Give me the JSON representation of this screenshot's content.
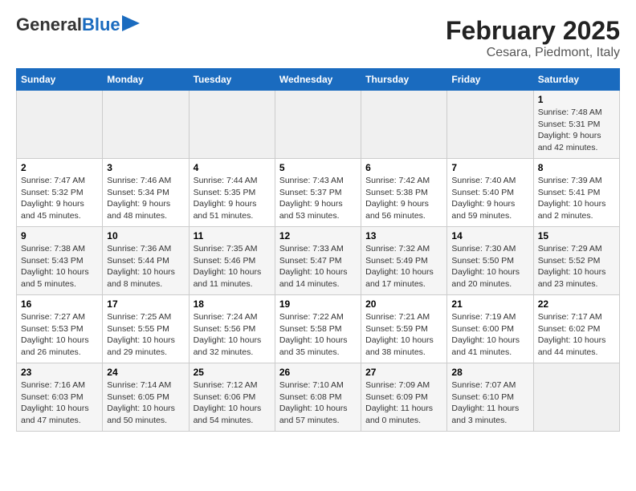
{
  "header": {
    "logo_line1": "General",
    "logo_line2": "Blue",
    "month_title": "February 2025",
    "location": "Cesara, Piedmont, Italy"
  },
  "weekdays": [
    "Sunday",
    "Monday",
    "Tuesday",
    "Wednesday",
    "Thursday",
    "Friday",
    "Saturday"
  ],
  "weeks": [
    [
      {
        "day": "",
        "sunrise": "",
        "sunset": "",
        "daylight": "",
        "empty": true
      },
      {
        "day": "",
        "sunrise": "",
        "sunset": "",
        "daylight": "",
        "empty": true
      },
      {
        "day": "",
        "sunrise": "",
        "sunset": "",
        "daylight": "",
        "empty": true
      },
      {
        "day": "",
        "sunrise": "",
        "sunset": "",
        "daylight": "",
        "empty": true
      },
      {
        "day": "",
        "sunrise": "",
        "sunset": "",
        "daylight": "",
        "empty": true
      },
      {
        "day": "",
        "sunrise": "",
        "sunset": "",
        "daylight": "",
        "empty": true
      },
      {
        "day": "1",
        "sunrise": "Sunrise: 7:48 AM",
        "sunset": "Sunset: 5:31 PM",
        "daylight": "Daylight: 9 hours and 42 minutes."
      }
    ],
    [
      {
        "day": "2",
        "sunrise": "Sunrise: 7:47 AM",
        "sunset": "Sunset: 5:32 PM",
        "daylight": "Daylight: 9 hours and 45 minutes."
      },
      {
        "day": "3",
        "sunrise": "Sunrise: 7:46 AM",
        "sunset": "Sunset: 5:34 PM",
        "daylight": "Daylight: 9 hours and 48 minutes."
      },
      {
        "day": "4",
        "sunrise": "Sunrise: 7:44 AM",
        "sunset": "Sunset: 5:35 PM",
        "daylight": "Daylight: 9 hours and 51 minutes."
      },
      {
        "day": "5",
        "sunrise": "Sunrise: 7:43 AM",
        "sunset": "Sunset: 5:37 PM",
        "daylight": "Daylight: 9 hours and 53 minutes."
      },
      {
        "day": "6",
        "sunrise": "Sunrise: 7:42 AM",
        "sunset": "Sunset: 5:38 PM",
        "daylight": "Daylight: 9 hours and 56 minutes."
      },
      {
        "day": "7",
        "sunrise": "Sunrise: 7:40 AM",
        "sunset": "Sunset: 5:40 PM",
        "daylight": "Daylight: 9 hours and 59 minutes."
      },
      {
        "day": "8",
        "sunrise": "Sunrise: 7:39 AM",
        "sunset": "Sunset: 5:41 PM",
        "daylight": "Daylight: 10 hours and 2 minutes."
      }
    ],
    [
      {
        "day": "9",
        "sunrise": "Sunrise: 7:38 AM",
        "sunset": "Sunset: 5:43 PM",
        "daylight": "Daylight: 10 hours and 5 minutes."
      },
      {
        "day": "10",
        "sunrise": "Sunrise: 7:36 AM",
        "sunset": "Sunset: 5:44 PM",
        "daylight": "Daylight: 10 hours and 8 minutes."
      },
      {
        "day": "11",
        "sunrise": "Sunrise: 7:35 AM",
        "sunset": "Sunset: 5:46 PM",
        "daylight": "Daylight: 10 hours and 11 minutes."
      },
      {
        "day": "12",
        "sunrise": "Sunrise: 7:33 AM",
        "sunset": "Sunset: 5:47 PM",
        "daylight": "Daylight: 10 hours and 14 minutes."
      },
      {
        "day": "13",
        "sunrise": "Sunrise: 7:32 AM",
        "sunset": "Sunset: 5:49 PM",
        "daylight": "Daylight: 10 hours and 17 minutes."
      },
      {
        "day": "14",
        "sunrise": "Sunrise: 7:30 AM",
        "sunset": "Sunset: 5:50 PM",
        "daylight": "Daylight: 10 hours and 20 minutes."
      },
      {
        "day": "15",
        "sunrise": "Sunrise: 7:29 AM",
        "sunset": "Sunset: 5:52 PM",
        "daylight": "Daylight: 10 hours and 23 minutes."
      }
    ],
    [
      {
        "day": "16",
        "sunrise": "Sunrise: 7:27 AM",
        "sunset": "Sunset: 5:53 PM",
        "daylight": "Daylight: 10 hours and 26 minutes."
      },
      {
        "day": "17",
        "sunrise": "Sunrise: 7:25 AM",
        "sunset": "Sunset: 5:55 PM",
        "daylight": "Daylight: 10 hours and 29 minutes."
      },
      {
        "day": "18",
        "sunrise": "Sunrise: 7:24 AM",
        "sunset": "Sunset: 5:56 PM",
        "daylight": "Daylight: 10 hours and 32 minutes."
      },
      {
        "day": "19",
        "sunrise": "Sunrise: 7:22 AM",
        "sunset": "Sunset: 5:58 PM",
        "daylight": "Daylight: 10 hours and 35 minutes."
      },
      {
        "day": "20",
        "sunrise": "Sunrise: 7:21 AM",
        "sunset": "Sunset: 5:59 PM",
        "daylight": "Daylight: 10 hours and 38 minutes."
      },
      {
        "day": "21",
        "sunrise": "Sunrise: 7:19 AM",
        "sunset": "Sunset: 6:00 PM",
        "daylight": "Daylight: 10 hours and 41 minutes."
      },
      {
        "day": "22",
        "sunrise": "Sunrise: 7:17 AM",
        "sunset": "Sunset: 6:02 PM",
        "daylight": "Daylight: 10 hours and 44 minutes."
      }
    ],
    [
      {
        "day": "23",
        "sunrise": "Sunrise: 7:16 AM",
        "sunset": "Sunset: 6:03 PM",
        "daylight": "Daylight: 10 hours and 47 minutes."
      },
      {
        "day": "24",
        "sunrise": "Sunrise: 7:14 AM",
        "sunset": "Sunset: 6:05 PM",
        "daylight": "Daylight: 10 hours and 50 minutes."
      },
      {
        "day": "25",
        "sunrise": "Sunrise: 7:12 AM",
        "sunset": "Sunset: 6:06 PM",
        "daylight": "Daylight: 10 hours and 54 minutes."
      },
      {
        "day": "26",
        "sunrise": "Sunrise: 7:10 AM",
        "sunset": "Sunset: 6:08 PM",
        "daylight": "Daylight: 10 hours and 57 minutes."
      },
      {
        "day": "27",
        "sunrise": "Sunrise: 7:09 AM",
        "sunset": "Sunset: 6:09 PM",
        "daylight": "Daylight: 11 hours and 0 minutes."
      },
      {
        "day": "28",
        "sunrise": "Sunrise: 7:07 AM",
        "sunset": "Sunset: 6:10 PM",
        "daylight": "Daylight: 11 hours and 3 minutes."
      },
      {
        "day": "",
        "sunrise": "",
        "sunset": "",
        "daylight": "",
        "empty": true
      }
    ]
  ]
}
